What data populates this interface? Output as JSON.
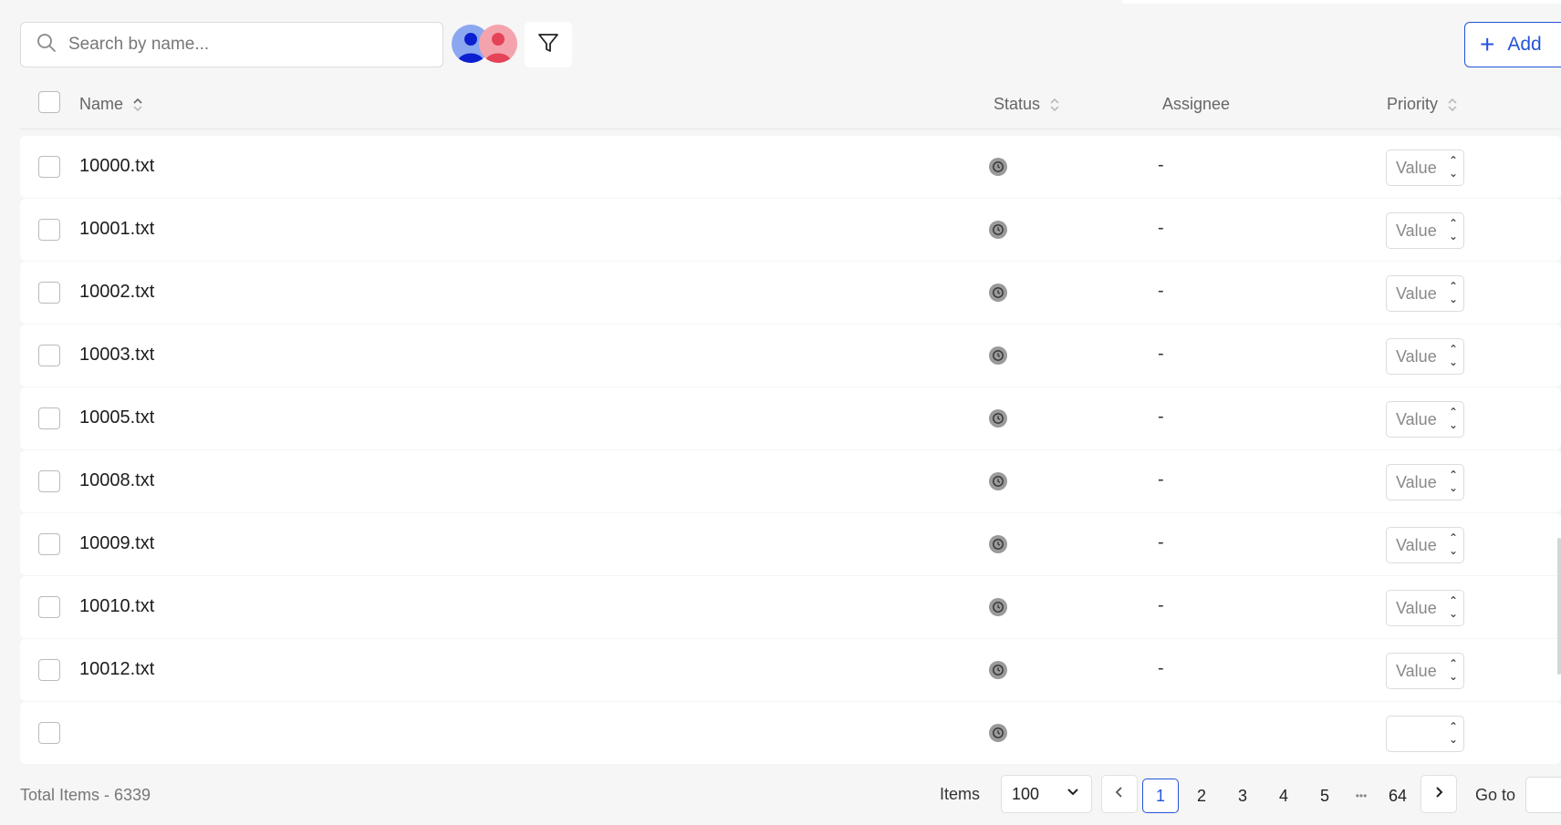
{
  "toolbar": {
    "search_placeholder": "Search by name...",
    "add_label": "Add"
  },
  "table": {
    "columns": {
      "name": "Name",
      "status": "Status",
      "assignee": "Assignee",
      "priority": "Priority"
    },
    "rows": [
      {
        "name": "10000.txt",
        "assignee": "-",
        "priority_placeholder": "Value"
      },
      {
        "name": "10001.txt",
        "assignee": "-",
        "priority_placeholder": "Value"
      },
      {
        "name": "10002.txt",
        "assignee": "-",
        "priority_placeholder": "Value"
      },
      {
        "name": "10003.txt",
        "assignee": "-",
        "priority_placeholder": "Value"
      },
      {
        "name": "10005.txt",
        "assignee": "-",
        "priority_placeholder": "Value"
      },
      {
        "name": "10008.txt",
        "assignee": "-",
        "priority_placeholder": "Value"
      },
      {
        "name": "10009.txt",
        "assignee": "-",
        "priority_placeholder": "Value"
      },
      {
        "name": "10010.txt",
        "assignee": "-",
        "priority_placeholder": "Value"
      },
      {
        "name": "10012.txt",
        "assignee": "-",
        "priority_placeholder": "Value"
      },
      {
        "name": "",
        "assignee": "",
        "priority_placeholder": ""
      }
    ]
  },
  "footer": {
    "total": "Total Items - 6339",
    "items_label": "Items",
    "items_per_page": "100",
    "pages": [
      "1",
      "2",
      "3",
      "4",
      "5"
    ],
    "ellipsis": "•••",
    "last_page": "64",
    "current_page": "1",
    "goto_label": "Go to"
  },
  "colors": {
    "accent": "#2554d8",
    "background": "#f6f6f6",
    "status_icon": "#9a9a9a"
  },
  "icons": {
    "search": "search-icon",
    "filter": "filter-icon",
    "add": "plus-icon",
    "status": "clock-icon",
    "sort": "sort-icon",
    "prev": "chevron-left-icon",
    "next": "chevron-right-icon",
    "dropdown": "chevron-down-icon"
  }
}
